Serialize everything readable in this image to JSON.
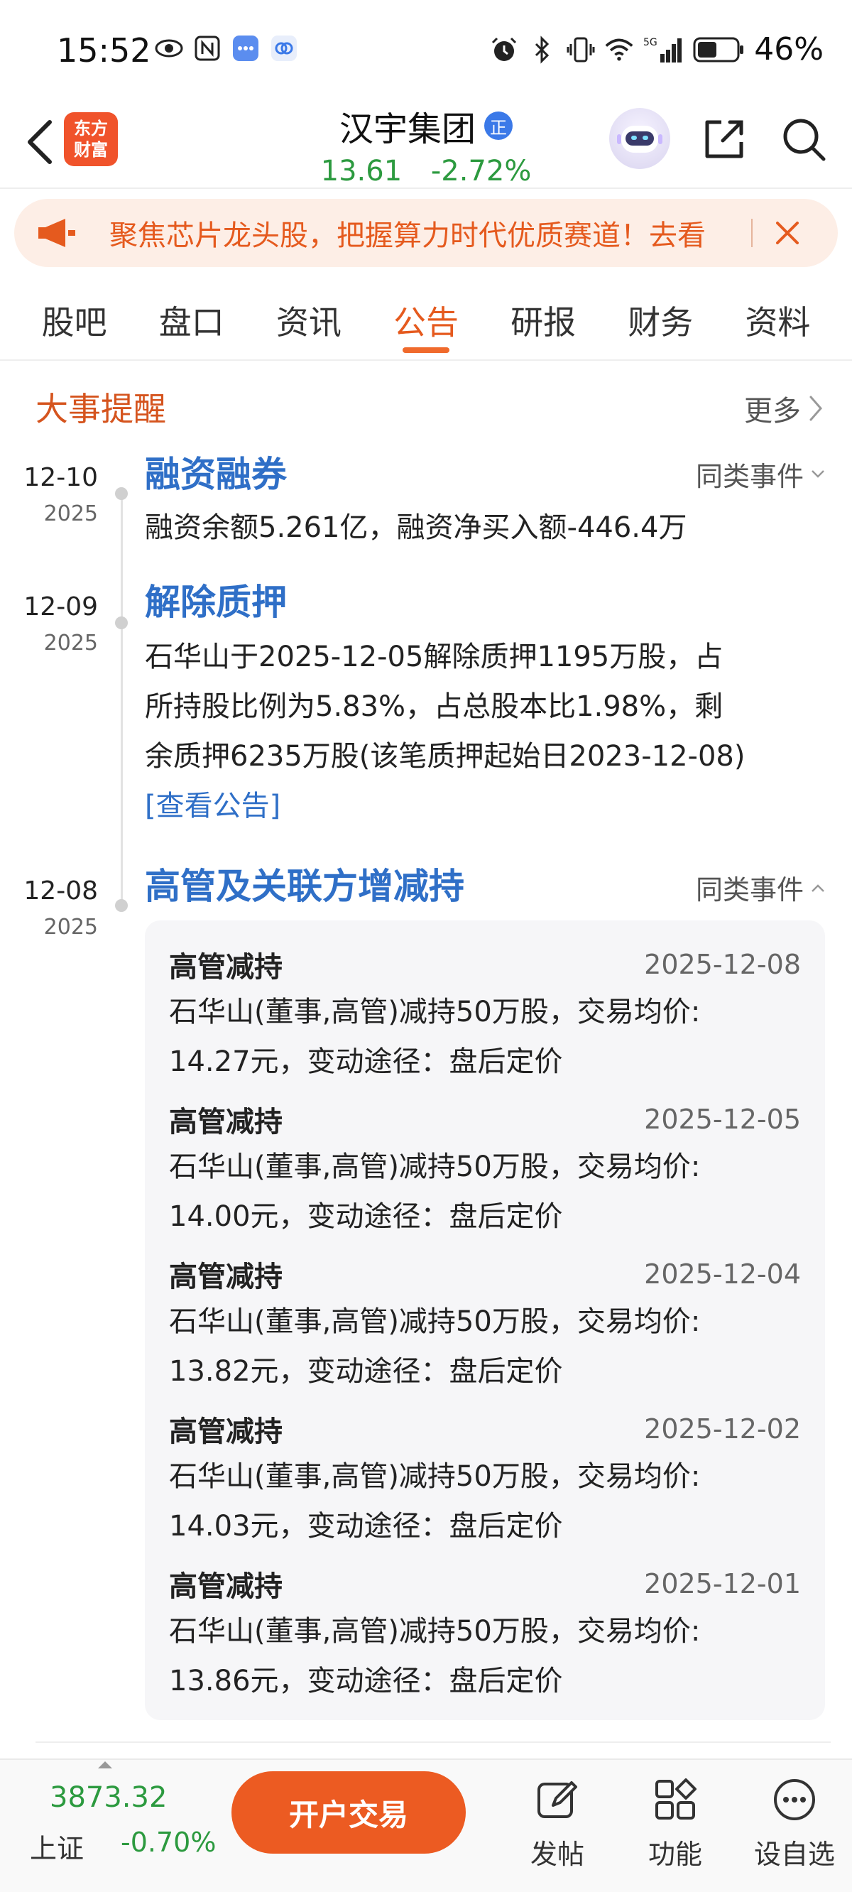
{
  "status_bar": {
    "time": "15:52",
    "network": "5G",
    "battery": "46%",
    "left_icons": [
      "eye-icon",
      "nfc-icon",
      "message-icon",
      "app-icon"
    ],
    "right_icons": [
      "alarm-icon",
      "bluetooth-icon",
      "vibrate-icon",
      "wifi-icon",
      "signal-icon",
      "battery-icon"
    ]
  },
  "header": {
    "logo_line1": "东方",
    "logo_line2": "财富",
    "stock_name": "汉宇集团",
    "badge": "正",
    "price": "13.61",
    "change_pct": "-2.72%"
  },
  "banner": {
    "text": "聚焦芯片龙头股，把握算力时代优质赛道！去看"
  },
  "tabs": [
    {
      "label": "股吧",
      "active": false
    },
    {
      "label": "盘口",
      "active": false
    },
    {
      "label": "资讯",
      "active": false
    },
    {
      "label": "公告",
      "active": true
    },
    {
      "label": "研报",
      "active": false
    },
    {
      "label": "财务",
      "active": false
    },
    {
      "label": "资料",
      "active": false
    }
  ],
  "section": {
    "title": "大事提醒",
    "more": "更多"
  },
  "events": [
    {
      "date_md": "12-10",
      "year": "2025",
      "title": "融资融券",
      "same_event": "同类事件",
      "body": "融资余额5.261亿，融资净买入额-446.4万"
    },
    {
      "date_md": "12-09",
      "year": "2025",
      "title": "解除质押",
      "body_line1": "石华山于2025-12-05解除质押1195万股，占",
      "body_line2": "所持股比例为5.83%，占总股本比1.98%，剩",
      "body_line3": "余质押6235万股(该笔质押起始日2023-12-08)",
      "link": "[查看公告]"
    },
    {
      "date_md": "12-08",
      "year": "2025",
      "title": "高管及关联方增减持",
      "same_event": "同类事件"
    }
  ],
  "details": [
    {
      "type": "高管减持",
      "date": "2025-12-08",
      "line1": "石华山(董事,高管)减持50万股，交易均价:",
      "line2": "14.27元，变动途径：盘后定价"
    },
    {
      "type": "高管减持",
      "date": "2025-12-05",
      "line1": "石华山(董事,高管)减持50万股，交易均价:",
      "line2": "14.00元，变动途径：盘后定价"
    },
    {
      "type": "高管减持",
      "date": "2025-12-04",
      "line1": "石华山(董事,高管)减持50万股，交易均价:",
      "line2": "13.82元，变动途径：盘后定价"
    },
    {
      "type": "高管减持",
      "date": "2025-12-02",
      "line1": "石华山(董事,高管)减持50万股，交易均价:",
      "line2": "14.03元，变动途径：盘后定价"
    },
    {
      "type": "高管减持",
      "date": "2025-12-01",
      "line1": "石华山(董事,高管)减持50万股，交易均价:",
      "line2": "13.86元，变动途径：盘后定价"
    }
  ],
  "bottom_bar": {
    "index_value": "3873.32",
    "index_name": "上证",
    "index_change": "-0.70%",
    "open_trade": "开户交易",
    "post": "发帖",
    "functions": "功能",
    "set_watch": "设自选"
  },
  "colors": {
    "accent": "#e55a1e",
    "link_blue": "#2f6fc7",
    "down_green": "#2c9a3f",
    "button_orange": "#ec5b22"
  }
}
